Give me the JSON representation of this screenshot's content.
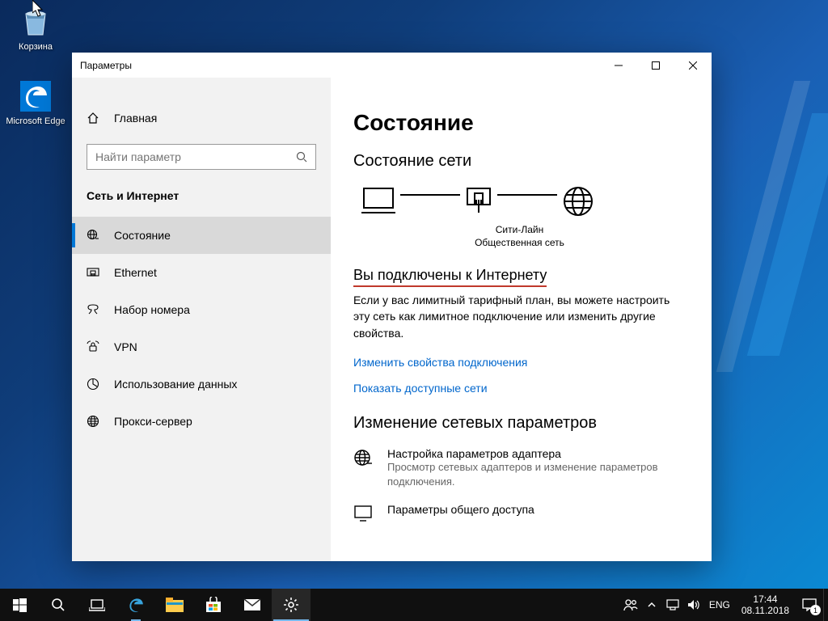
{
  "desktop": {
    "recycle_bin": "Корзина",
    "edge": "Microsoft Edge"
  },
  "window": {
    "title": "Параметры"
  },
  "sidebar": {
    "home": "Главная",
    "search_placeholder": "Найти параметр",
    "category": "Сеть и Интернет",
    "items": [
      {
        "label": "Состояние"
      },
      {
        "label": "Ethernet"
      },
      {
        "label": "Набор номера"
      },
      {
        "label": "VPN"
      },
      {
        "label": "Использование данных"
      },
      {
        "label": "Прокси-сервер"
      }
    ]
  },
  "content": {
    "title": "Состояние",
    "subtitle": "Состояние сети",
    "diagram": {
      "name": "Сити-Лайн",
      "type": "Общественная сеть"
    },
    "connected_heading": "Вы подключены к Интернету",
    "connected_body": "Если у вас лимитный тарифный план, вы можете настроить эту сеть как лимитное подключение или изменить другие свойства.",
    "link_change_props": "Изменить свойства подключения",
    "link_show_nets": "Показать доступные сети",
    "change_settings_heading": "Изменение сетевых параметров",
    "opt_adapter_title": "Настройка параметров адаптера",
    "opt_adapter_desc": "Просмотр сетевых адаптеров и изменение параметров подключения.",
    "opt_sharing_title": "Параметры общего доступа"
  },
  "taskbar": {
    "lang": "ENG",
    "time": "17:44",
    "date": "08.11.2018",
    "notif_count": "1"
  }
}
